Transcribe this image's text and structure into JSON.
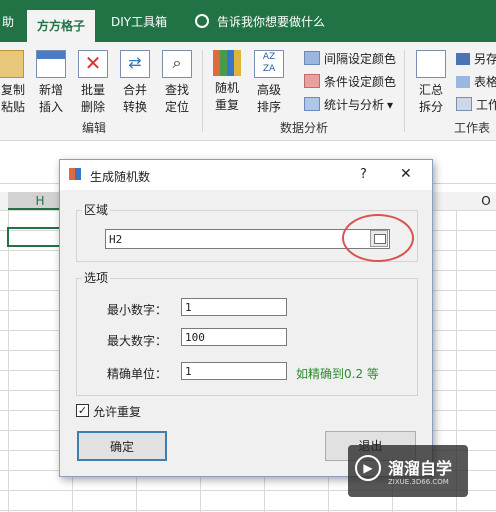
{
  "ribbon": {
    "tabs": [
      "助",
      "方方格子",
      "DIY工具箱"
    ],
    "search_text": "告诉我你想要做什么",
    "buttons": [
      {
        "label": "复制粘贴",
        "sub": ""
      },
      {
        "label": "新增插入",
        "sub": ""
      },
      {
        "label": "批量删除",
        "sub": ""
      },
      {
        "label": "合并转换",
        "sub": ""
      },
      {
        "label": "查找定位",
        "sub": ""
      },
      {
        "label": "随机重复",
        "sub": ""
      },
      {
        "label": "高级排序",
        "sub": ""
      }
    ],
    "small_buttons": [
      "间隔设定颜色",
      "条件设定颜色",
      "统计与分析"
    ],
    "right_buttons": [
      "汇总拆分",
      "另存",
      "表格",
      "工作"
    ],
    "groups": [
      "编辑",
      "数据分析",
      "工作表"
    ]
  },
  "sheet": {
    "col_left": "H",
    "col_right": "O"
  },
  "dialog": {
    "title": "生成随机数",
    "help": "?",
    "close": "✕",
    "range_legend": "区域",
    "range_value": "H2",
    "options_legend": "选项",
    "min_label": "最小数字：",
    "min_value": "1",
    "max_label": "最大数字：",
    "max_value": "100",
    "precision_label": "精确单位：",
    "precision_value": "1",
    "precision_hint": "如精确到0.2 等",
    "allow_repeat_label": "允许重复",
    "allow_repeat_checked": true,
    "ok_label": "确定",
    "exit_label": "退出"
  },
  "watermark": {
    "brand": "溜溜自学",
    "url": "ZIXUE.3D66.COM"
  },
  "colors": {
    "excel_green": "#217346",
    "annotation_red": "#d9534f",
    "hint_green": "#2e8b2e"
  }
}
